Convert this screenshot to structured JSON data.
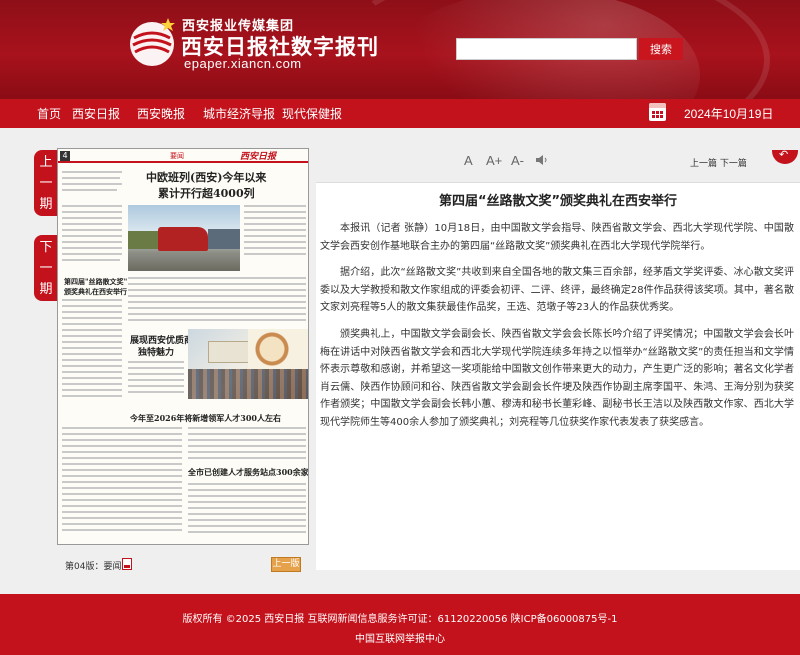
{
  "header": {
    "group_name": "西安报业传媒集团",
    "site_title": "西安日报社数字报刊",
    "site_url": "epaper.xiancn.com",
    "search_placeholder": "",
    "search_label": "搜索"
  },
  "nav": {
    "items": [
      "首页",
      "西安日报",
      "西安晚报",
      "城市经济导报",
      "现代保健报"
    ],
    "date": "2024年10月19日"
  },
  "side": {
    "prev_issue": [
      "上",
      "一",
      "期"
    ],
    "next_issue": [
      "下",
      "一",
      "期"
    ]
  },
  "paper": {
    "page_no": "4",
    "section": "要闻",
    "masthead_logo": "西安日报",
    "headline_1a": "中欧班列(西安)今年以来",
    "headline_1b": "累计开行超4000列",
    "headline_2a": "第四届\"丝路散文奖\"",
    "headline_2b": "颁奖典礼在西安举行",
    "headline_3a": "展现西安优质商品",
    "headline_3b": "独特魅力",
    "headline_4": "今年至2026年将新增领军人才300人左右",
    "headline_5": "全市已创建人才服务站点300余家"
  },
  "paper_footer": {
    "page_label": "第04版：要闻",
    "prev_page": "上一版"
  },
  "toolbar": {
    "font_a": "A",
    "font_up": "A+",
    "font_down": "A-",
    "prev_next": "上一篇 下一篇"
  },
  "article": {
    "title": "第四届“丝路散文奖”颁奖典礼在西安举行",
    "paragraphs": [
      "本报讯（记者 张静）10月18日，由中国散文学会指导、陕西省散文学会、西北大学现代学院、中国散文学会西安创作基地联合主办的第四届“丝路散文奖”颁奖典礼在西北大学现代学院举行。",
      "据介绍，此次“丝路散文奖”共收到来自全国各地的散文集三百余部，经茅盾文学奖评委、冰心散文奖评委以及大学教授和散文作家组成的评委会初评、二评、终评，最终确定28件作品获得该奖项。其中，著名散文家刘亮程等5人的散文集获最佳作品奖，王选、范墩子等23人的作品获优秀奖。",
      "颁奖典礼上，中国散文学会副会长、陕西省散文学会会长陈长吟介绍了评奖情况；中国散文学会会长叶梅在讲话中对陕西省散文学会和西北大学现代学院连续多年持之以恒举办“丝路散文奖”的责任担当和文学情怀表示尊敬和感谢，并希望这一奖项能给中国散文创作带来更大的动力，产生更广泛的影响；著名文化学者肖云儒、陕西作协顾问和谷、陕西省散文学会副会长仵埂及陕西作协副主席李国平、朱鸿、王海分别为获奖作者颁奖；中国散文学会副会长韩小蕙、穆涛和秘书长董彩峰、副秘书长王洁以及陕西散文作家、西北大学现代学院师生等400余人参加了颁奖典礼；刘亮程等几位获奖作家代表发表了获奖感言。"
    ]
  },
  "footer": {
    "copyright": "版权所有 ©2025 西安日报 互联网新闻信息服务许可证：61120220056 陕ICP备06000875号-1",
    "report": "中国互联网举报中心"
  },
  "colors": {
    "brand_red": "#c4121c",
    "header_red": "#a8121c",
    "button_orange": "#e6a24b"
  }
}
